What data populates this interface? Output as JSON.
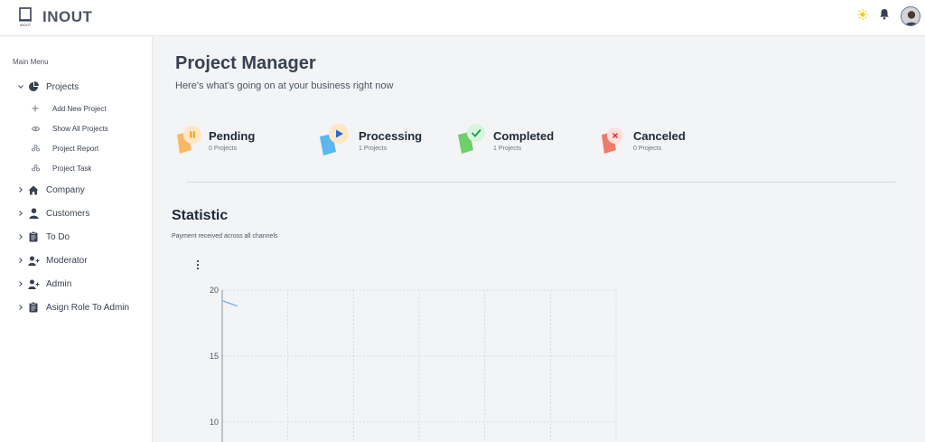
{
  "app": {
    "name": "INOUT",
    "logo_text": "INOUT"
  },
  "header": {
    "icons": [
      "sun-icon",
      "bell-icon",
      "avatar"
    ]
  },
  "sidebar": {
    "menu_title": "Main Menu",
    "items": [
      {
        "label": "Projects",
        "icon": "pie-chart-icon",
        "expanded": true,
        "children": [
          {
            "label": "Add New Project",
            "icon": "plus-icon"
          },
          {
            "label": "Show All Projects",
            "icon": "eye-icon"
          },
          {
            "label": "Project Report",
            "icon": "group-icon"
          },
          {
            "label": "Project Task",
            "icon": "group-icon"
          }
        ]
      },
      {
        "label": "Company",
        "icon": "home-icon"
      },
      {
        "label": "Customers",
        "icon": "user-icon"
      },
      {
        "label": "To Do",
        "icon": "clipboard-icon"
      },
      {
        "label": "Moderator",
        "icon": "user-plus-icon"
      },
      {
        "label": "Admin",
        "icon": "user-plus-icon"
      },
      {
        "label": "Asign Role To Admin",
        "icon": "clipboard-icon"
      }
    ]
  },
  "main": {
    "title": "Project Manager",
    "subtitle": "Here's what's going on at your business right now",
    "status_cards": [
      {
        "name": "Pending",
        "count": "0 Projects",
        "color": "#f9b868",
        "icon": "pause-icon"
      },
      {
        "name": "Processing",
        "count": "1 Projects",
        "color": "#5ab7f0",
        "icon": "play-icon"
      },
      {
        "name": "Completed",
        "count": "1 Projects",
        "color": "#6fcf6a",
        "icon": "check-icon"
      },
      {
        "name": "Canceled",
        "count": "0 Projects",
        "color": "#ef7a6a",
        "icon": "close-icon"
      }
    ],
    "statistic": {
      "title": "Statistic",
      "subtitle": "Payment received across all channels"
    }
  },
  "chart_data": {
    "type": "line",
    "title": "",
    "xlabel": "",
    "ylabel": "",
    "y_tick_labels": [
      "20",
      "15",
      "10"
    ],
    "y_ticks": [
      20,
      15,
      10
    ],
    "ylim_visible": [
      10,
      20
    ],
    "x_grid_columns": 6,
    "grid": true,
    "series": [
      {
        "points": [
          [
            0,
            19.2
          ],
          [
            0.23,
            18.8
          ]
        ],
        "color": "#60a5fa"
      }
    ]
  },
  "colors": {
    "accent": "#3b82f6",
    "sun": "#facc15"
  }
}
